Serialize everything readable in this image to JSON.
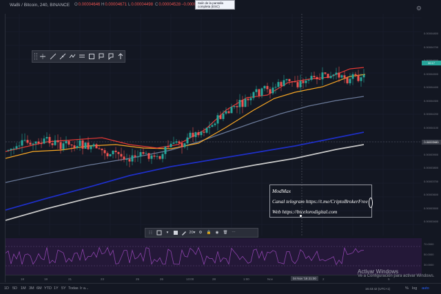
{
  "header": {
    "symbol": "WaBi / Bitcoin, 240, BINANCE",
    "ohlc": [
      {
        "key": "O",
        "value": "0.00004646"
      },
      {
        "key": "H",
        "value": "0.00004671"
      },
      {
        "key": "L",
        "value": "0.00004498"
      },
      {
        "key": "C",
        "value": "0.00004528"
      },
      {
        "key": "",
        "value": "−0.00000118 (−2.54%)"
      }
    ],
    "tooltip": "Salir de la pantalla completa (ESC)"
  },
  "textbox": {
    "line1": "ModMax",
    "line2": "Canal telegram https://t.me/CriptoBrokerFree",
    "line3": "Web https://btcelorodigital.com"
  },
  "price_axis": {
    "ticks": [
      "0.00004800",
      "0.00004700",
      "0.00004600",
      "0.00004500",
      "0.00004400",
      "0.00004300",
      "0.00004200",
      "0.00004100",
      "0.00004000",
      "0.00003900",
      "0.00003800",
      "0.00003700",
      "0.00003600",
      "0.00003500",
      "0.00003400"
    ],
    "last_price_label": "30:17",
    "cursor_price_label": "0.00003980",
    "rsi_ticks": [
      "70.0000",
      "50.0000",
      "30.0000"
    ]
  },
  "time_axis": {
    "ticks": [
      "18",
      "19",
      "21",
      "23",
      "25",
      "26",
      "13:00",
      "28",
      "1:00",
      "Nov",
      "2",
      "",
      "5"
    ],
    "cursor_label": "04 Nov '18  21:00"
  },
  "property_toolbar": {
    "font_size": "20"
  },
  "bottom_bar": {
    "ranges": [
      "1D",
      "5D",
      "1M",
      "3M",
      "6M",
      "YTD",
      "1Y",
      "5Y",
      "Todas"
    ],
    "goto": "Ir a...",
    "clock": "16:43:42 (UTC+1)",
    "toggles": [
      "%",
      "log",
      "auto"
    ]
  },
  "watermark": {
    "title": "Activar Windows",
    "subtitle": "Ve a Configuración para activar Windows."
  },
  "colors": {
    "background": "#131722",
    "up": "#26a69a",
    "down": "#ef5350",
    "ma_fast": "#e53935",
    "ma_mid": "#f9a825",
    "ma_slow": "#6b7a99",
    "ma_blue": "#1e2fc7",
    "ma_white": "#c9c9c9",
    "rsi_line": "#8e44ad",
    "rsi_bg": "#241838"
  },
  "icons": [
    "cursor-icon",
    "trend-line-icon",
    "fib-icon",
    "pattern-icon",
    "text-icon",
    "rectangle-icon",
    "brush-icon",
    "measure-icon",
    "arrow-icon"
  ]
}
